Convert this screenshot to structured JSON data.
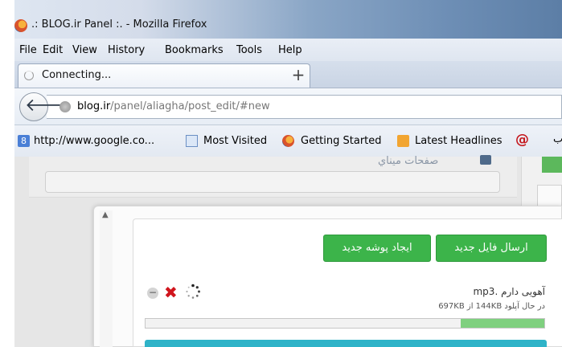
{
  "window": {
    "title": ".: BLOG.ir Panel :. - Mozilla Firefox"
  },
  "menu": [
    "File",
    "Edit",
    "View",
    "History",
    "Bookmarks",
    "Tools",
    "Help"
  ],
  "tab": {
    "label": "Connecting...",
    "new_tab": "+"
  },
  "address": {
    "host": "blog.ir",
    "path": "/panel/aliagha/post_edit/#new"
  },
  "bookmarks": [
    {
      "label": "http://www.google.co...",
      "icon": "google-icon"
    },
    {
      "label": "Most Visited",
      "icon": "page-icon"
    },
    {
      "label": "Getting Started",
      "icon": "firefox-icon"
    },
    {
      "label": "Latest Headlines",
      "icon": "rss-icon"
    },
    {
      "label": "@",
      "icon": "at-icon"
    },
    {
      "label": "ب"
    }
  ],
  "page": {
    "heading": "صفحات ميناي"
  },
  "modal": {
    "upload_button": "ارسال فایل جدید",
    "new_folder_button": "ایجاد پوشه جدید",
    "file": {
      "name": "آهویی دارم .mp3",
      "status": "در حال آپلود 144KB از 697KB",
      "progress": 0.21
    }
  },
  "colors": {
    "green_button": "#3cb44a",
    "cancel_x": "#d0151d",
    "progress_fill": "#7fd07f",
    "teal_bar": "#2fb3c8"
  }
}
